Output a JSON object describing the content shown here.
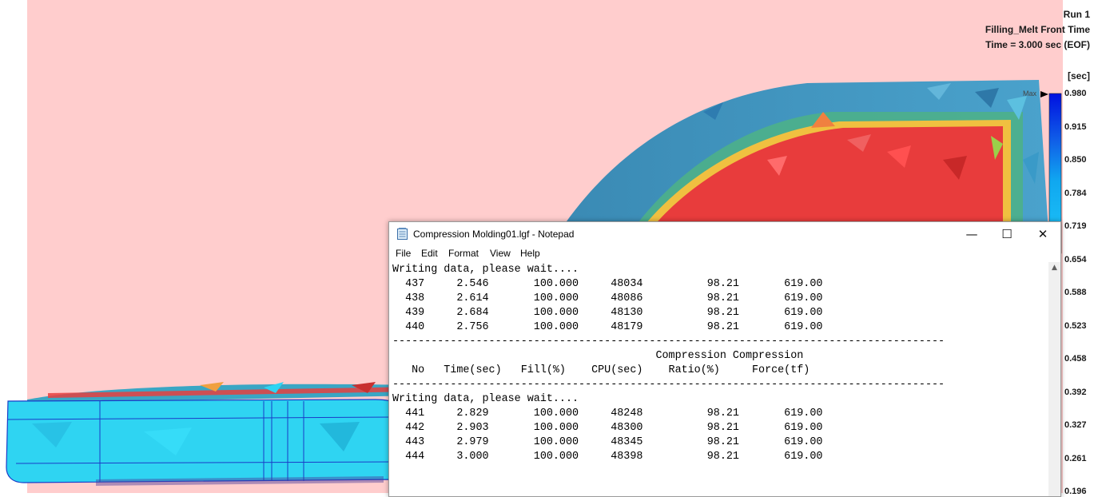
{
  "viewer": {
    "run_label": "Run 1",
    "result_name": "Filling_Melt Front Time",
    "time_label": "Time = 3.000 sec (EOF)",
    "legend": {
      "unit": "[sec]",
      "max_marker": "Max",
      "values": [
        "0.980",
        "0.915",
        "0.850",
        "0.784",
        "0.719",
        "0.654",
        "0.588",
        "0.523",
        "0.458",
        "0.392",
        "0.327",
        "0.261",
        "0.196"
      ]
    },
    "colors": {
      "background": "#ffcdcd",
      "filled_red": "#e83c3c",
      "melt_front": "#f0c040",
      "shell_blue": "#3d8fb8",
      "part_cyan": "#2fd4f2",
      "edge_blue": "#1a3cc8"
    }
  },
  "notepad": {
    "title": "Compression Molding01.lgf - Notepad",
    "icon": "notepad-icon",
    "window_controls": {
      "minimize": "—",
      "maximize": "☐",
      "close": "✕"
    },
    "menu": [
      "File",
      "Edit",
      "Format",
      "View",
      "Help"
    ],
    "content": "Writing data, please wait....\n  437     2.546       100.000     48034          98.21       619.00\n  438     2.614       100.000     48086          98.21       619.00\n  439     2.684       100.000     48130          98.21       619.00\n  440     2.756       100.000     48179          98.21       619.00\n--------------------------------------------------------------------------------------\n                                         Compression Compression\n   No   Time(sec)   Fill(%)    CPU(sec)    Ratio(%)     Force(tf)\n--------------------------------------------------------------------------------------\nWriting data, please wait....\n  441     2.829       100.000     48248          98.21       619.00\n  442     2.903       100.000     48300          98.21       619.00\n  443     2.979       100.000     48345          98.21       619.00\n  444     3.000       100.000     48398          98.21       619.00",
    "scroll_up_glyph": "▲"
  }
}
